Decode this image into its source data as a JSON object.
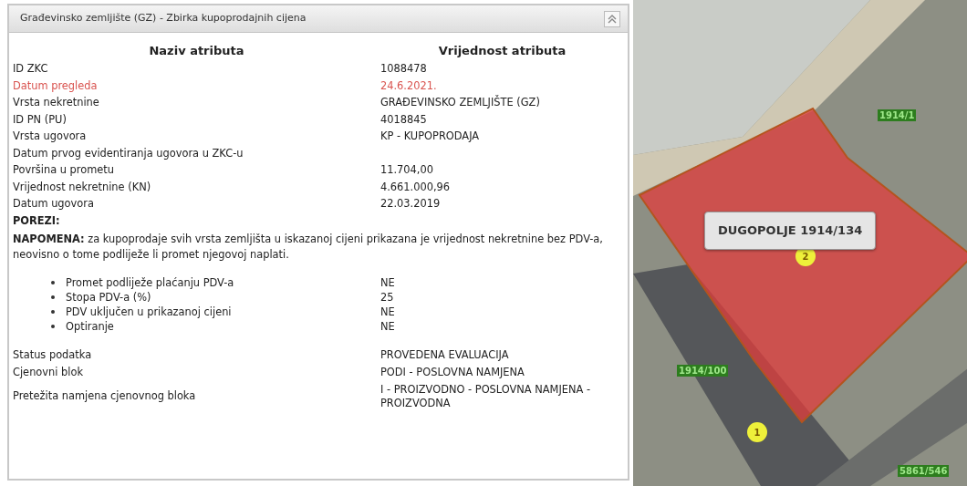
{
  "panel": {
    "title": "Građevinsko zemljište (GZ) - Zbirka kupoprodajnih cijena"
  },
  "table": {
    "columns": [
      "Naziv atributa",
      "Vrijednost atributa"
    ],
    "rows": [
      {
        "label": "ID ZKC",
        "value": "1088478",
        "highlighted": false
      },
      {
        "label": "Datum pregleda",
        "value": "24.6.2021.",
        "highlighted": true
      },
      {
        "label": "Vrsta nekretnine",
        "value": "GRAĐEVINSKO ZEMLJIŠTE (GZ)",
        "highlighted": false
      },
      {
        "label": "ID PN (PU)",
        "value": "4018845",
        "highlighted": false
      },
      {
        "label": "Vrsta ugovora",
        "value": "KP - KUPOPRODAJA",
        "highlighted": false
      },
      {
        "label": "Datum prvog evidentiranja ugovora u ZKC-u",
        "highlighted": false
      },
      {
        "label": "Površina u prometu",
        "value": "11.704,00",
        "highlighted": false
      },
      {
        "label": "Vrijednost nekretnine (KN)",
        "value": "4.661.000,96",
        "highlighted": false
      },
      {
        "label": "Datum ugovora",
        "value": "22.03.2019",
        "highlighted": false
      }
    ]
  },
  "taxes": {
    "heading": "POREZI:",
    "note": "**NAPOMENA:** za kupoprodaje svih vrsta zemljišta u iskazanoj cijeni prikazana je vrijednost nekretnine bez PDV-a, neovisno o tome podliježe li promet njegovoj naplati.",
    "items": [
      {
        "label": "Promet podliježe plaćanju PDV-a",
        "value": "NE"
      },
      {
        "label": "Stopa PDV-a (%)",
        "value": "25"
      },
      {
        "label": "PDV uključen u prikazanoj cijeni",
        "value": "NE"
      },
      {
        "label": "Optiranje",
        "value": "NE"
      }
    ]
  },
  "status_rows": [
    {
      "label": "Status podatka",
      "value": "PROVEDENA EVALUACIJA"
    },
    {
      "label": "Cjenovni blok",
      "value": "PODI - POSLOVNA NAMJENA"
    },
    {
      "label": "Pretežita namjena cjenovnog bloka",
      "value": "I - PROIZVODNO - POSLOVNA NAMJENA - PROIZVODNA"
    }
  ],
  "map": {
    "popup": "DUGOPOLJE 1914/134",
    "parcel_labels": [
      "1914/1",
      "1914/100",
      "5861/546"
    ],
    "markers": [
      "2",
      "1"
    ]
  }
}
